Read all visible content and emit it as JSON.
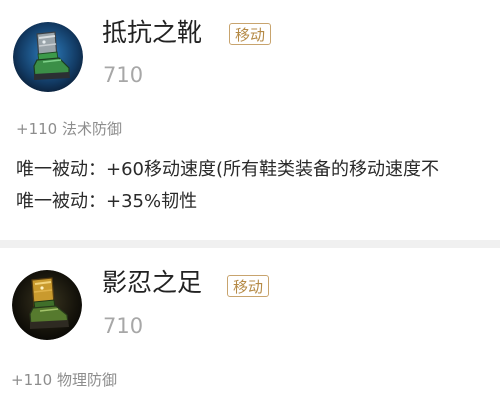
{
  "items": [
    {
      "name": "抵抗之靴",
      "type_tag": "移动",
      "price": "710",
      "stat": "+110 法术防御",
      "passives": [
        "唯一被动：+60移动速度(所有鞋类装备的移动速度不",
        "唯一被动：+35%韧性"
      ],
      "icon": "green-boot-icon"
    },
    {
      "name": "影忍之足",
      "type_tag": "移动",
      "price": "710",
      "stat": "+110 物理防御",
      "icon": "golden-boot-icon"
    }
  ],
  "colors": {
    "tag_border": "#c8a46e",
    "tag_text": "#b58a46",
    "price": "#a7a7a7",
    "stat": "#8d8d8d",
    "divider": "#f0f0f0"
  }
}
